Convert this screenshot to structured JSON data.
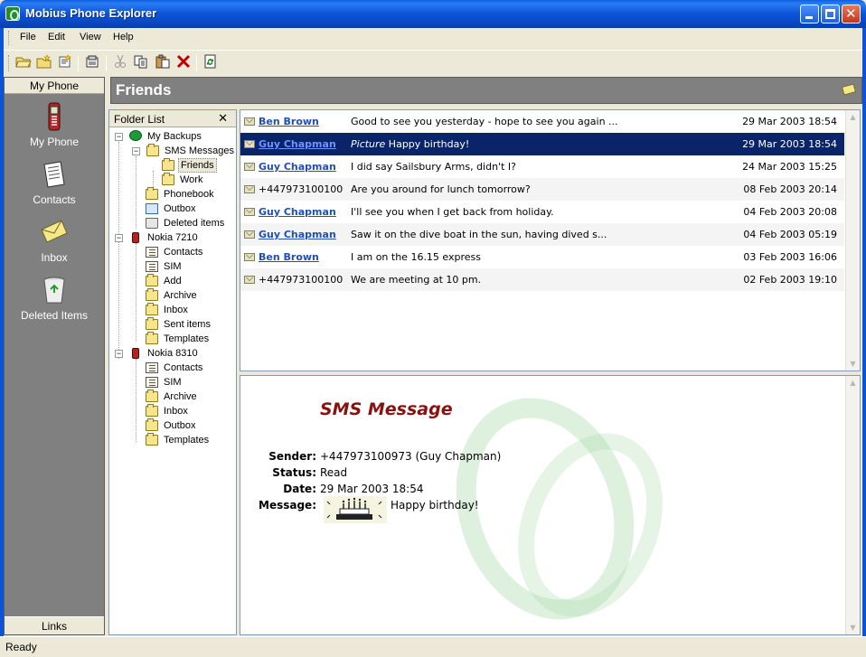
{
  "window": {
    "title": "Mobius Phone Explorer"
  },
  "menu": [
    "File",
    "Edit",
    "View",
    "Help"
  ],
  "toolbar": {
    "buttons": [
      "open-folder-icon",
      "new-folder-icon",
      "new-message-icon",
      "properties-icon",
      "cut-icon",
      "copy-icon",
      "paste-icon",
      "delete-icon",
      "sync-icon"
    ]
  },
  "sidebar": {
    "header": "My Phone",
    "items": [
      {
        "label": "My Phone",
        "icon": "phone-icon"
      },
      {
        "label": "Contacts",
        "icon": "contacts-icon"
      },
      {
        "label": "Inbox",
        "icon": "inbox-icon"
      },
      {
        "label": "Deleted Items",
        "icon": "recycle-bin-icon"
      }
    ],
    "footer": "Links"
  },
  "header": {
    "title": "Friends"
  },
  "folder_panel": {
    "title": "Folder List",
    "close": "✕",
    "tree": [
      {
        "label": "My Backups",
        "icon": "backup-icon",
        "level": 0,
        "expander": "−"
      },
      {
        "label": "SMS Messages",
        "icon": "folder-icon",
        "level": 1,
        "expander": "−"
      },
      {
        "label": "Friends",
        "icon": "folder-icon",
        "level": 2,
        "selected": true
      },
      {
        "label": "Work",
        "icon": "folder-icon",
        "level": 2
      },
      {
        "label": "Phonebook",
        "icon": "folder-icon",
        "level": 1
      },
      {
        "label": "Outbox",
        "icon": "outbox-icon",
        "level": 1
      },
      {
        "label": "Deleted items",
        "icon": "recycle-bin-icon",
        "level": 1
      },
      {
        "label": "Nokia 7210",
        "icon": "phone-icon",
        "level": 0,
        "expander": "−"
      },
      {
        "label": "Contacts",
        "icon": "address-book-icon",
        "level": 1
      },
      {
        "label": "SIM",
        "icon": "address-book-icon",
        "level": 1
      },
      {
        "label": "Add",
        "icon": "message-folder-icon",
        "level": 1
      },
      {
        "label": "Archive",
        "icon": "message-folder-icon",
        "level": 1
      },
      {
        "label": "Inbox",
        "icon": "message-folder-icon",
        "level": 1
      },
      {
        "label": "Sent items",
        "icon": "message-folder-icon",
        "level": 1
      },
      {
        "label": "Templates",
        "icon": "message-folder-icon",
        "level": 1
      },
      {
        "label": "Nokia 8310",
        "icon": "phone-icon",
        "level": 0,
        "expander": "−"
      },
      {
        "label": "Contacts",
        "icon": "address-book-icon",
        "level": 1
      },
      {
        "label": "SIM",
        "icon": "address-book-icon",
        "level": 1
      },
      {
        "label": "Archive",
        "icon": "message-folder-icon",
        "level": 1
      },
      {
        "label": "Inbox",
        "icon": "message-folder-icon",
        "level": 1
      },
      {
        "label": "Outbox",
        "icon": "message-folder-icon",
        "level": 1
      },
      {
        "label": "Templates",
        "icon": "message-folder-icon",
        "level": 1
      }
    ]
  },
  "messages": [
    {
      "sender": "Ben Brown",
      "linked": true,
      "prefix": "",
      "text": "Good to see you yesterday - hope to see you again ...",
      "date": "29 Mar 2003 18:54"
    },
    {
      "sender": "Guy Chapman",
      "linked": true,
      "prefix": "Picture",
      "text": " Happy birthday!",
      "date": "29 Mar 2003 18:54",
      "selected": true
    },
    {
      "sender": "Guy Chapman",
      "linked": true,
      "prefix": "",
      "text": "I did say Sailsbury Arms, didn't I?",
      "date": "24 Mar 2003 15:25"
    },
    {
      "sender": "+447973100100",
      "linked": false,
      "prefix": "",
      "text": "Are you around for lunch tomorrow?",
      "date": "08 Feb 2003 20:14"
    },
    {
      "sender": "Guy Chapman",
      "linked": true,
      "prefix": "",
      "text": "I'll see you when I get back from holiday.",
      "date": "04 Feb 2003 20:08"
    },
    {
      "sender": "Guy Chapman",
      "linked": true,
      "prefix": "",
      "text": "Saw it on the dive boat in the sun, having dived s...",
      "date": "04 Feb 2003 05:19"
    },
    {
      "sender": "Ben Brown",
      "linked": true,
      "prefix": "",
      "text": "I am on the 16.15 express",
      "date": "03 Feb 2003 16:06"
    },
    {
      "sender": "+447973100100",
      "linked": false,
      "prefix": "",
      "text": "We are meeting at 10 pm.",
      "date": "02 Feb 2003 19:10"
    }
  ],
  "preview": {
    "title": "SMS Message",
    "fields": [
      {
        "label": "Sender:",
        "value": "+447973100973 (Guy Chapman)"
      },
      {
        "label": "Status:",
        "value": "Read"
      },
      {
        "label": "Date:",
        "value": "29 Mar 2003 18:54"
      },
      {
        "label": "Message:",
        "value": "Happy birthday!"
      }
    ],
    "picture": "birthday-cake-picture"
  },
  "status": {
    "text": "Ready"
  },
  "colors": {
    "titlebar": "#0a54d8",
    "selection": "#0a246a",
    "link": "#1f4fb8",
    "sms_title": "#8b1010",
    "panel_gray": "#808080"
  }
}
